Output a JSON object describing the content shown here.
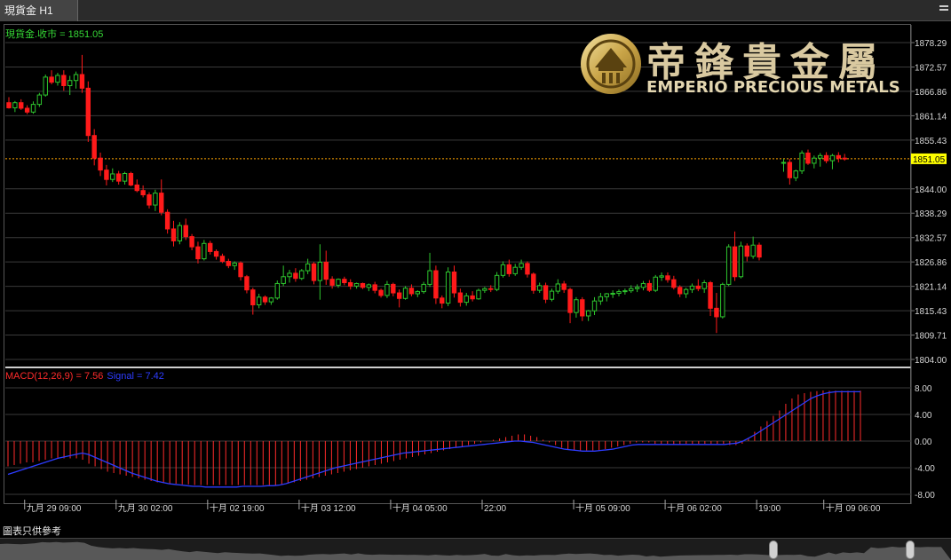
{
  "tab": {
    "title": "現貨金 H1"
  },
  "price_panel": {
    "label": "現貨金.收市 = 1851.05",
    "current_price_tag": "1851.05"
  },
  "macd_panel": {
    "label_macd": "MACD(12,26,9) = 7.56",
    "label_signal": "Signal = 7.42"
  },
  "logo": {
    "chinese": "帝鋒貴金屬",
    "english": "EMPERIO PRECIOUS METALS"
  },
  "disclaimer": "圖表只供參考",
  "colors": {
    "up": "#2ec52e",
    "down": "#ff1a1a",
    "signal": "#2d3cff",
    "histogram": "#ff2b2b",
    "current_line": "#ffa500",
    "tag_bg": "#ffff00",
    "logo_gold": "#d4af37"
  },
  "chart_data": {
    "type": "candlestick",
    "title": "現貨金.收市 = 1851.05",
    "y_ticks": [
      "1878.29",
      "1872.57",
      "1866.86",
      "1861.14",
      "1855.43",
      "1844.00",
      "1838.29",
      "1832.57",
      "1826.86",
      "1821.14",
      "1815.43",
      "1809.71",
      "1804.00"
    ],
    "ylim": [
      1804.0,
      1880.5
    ],
    "current_price": 1851.05,
    "x_ticks": [
      {
        "label": "九月 29 09:00",
        "index": 2
      },
      {
        "label": "九月 30 02:00",
        "index": 17
      },
      {
        "label": "十月 02 19:00",
        "index": 32
      },
      {
        "label": "十月 03 12:00",
        "index": 47
      },
      {
        "label": "十月 04 05:00",
        "index": 62
      },
      {
        "label": "22:00",
        "index": 77
      },
      {
        "label": "十月 05 09:00",
        "index": 92
      },
      {
        "label": "十月 06 02:00",
        "index": 107
      },
      {
        "label": "19:00",
        "index": 122
      },
      {
        "label": "十月 09 06:00",
        "index": 133
      }
    ],
    "candles": [
      [
        1864.2,
        1865.5,
        1862.8,
        1863.0
      ],
      [
        1863.0,
        1864.6,
        1862.0,
        1864.2
      ],
      [
        1864.2,
        1865.0,
        1862.5,
        1862.9
      ],
      [
        1862.9,
        1863.6,
        1861.5,
        1862.0
      ],
      [
        1862.0,
        1864.5,
        1861.6,
        1863.8
      ],
      [
        1863.8,
        1866.5,
        1863.2,
        1866.0
      ],
      [
        1866.0,
        1870.8,
        1865.6,
        1870.2
      ],
      [
        1870.2,
        1871.8,
        1868.5,
        1869.0
      ],
      [
        1869.0,
        1871.2,
        1868.2,
        1870.6
      ],
      [
        1870.6,
        1871.8,
        1867.0,
        1868.2
      ],
      [
        1868.2,
        1870.5,
        1866.0,
        1869.4
      ],
      [
        1869.4,
        1871.5,
        1867.5,
        1870.8
      ],
      [
        1870.8,
        1875.4,
        1866.5,
        1867.6
      ],
      [
        1867.6,
        1869.2,
        1855.0,
        1856.5
      ],
      [
        1856.5,
        1858.0,
        1849.5,
        1851.2
      ],
      [
        1851.2,
        1852.5,
        1847.0,
        1848.4
      ],
      [
        1848.4,
        1849.6,
        1844.8,
        1846.2
      ],
      [
        1846.2,
        1848.8,
        1845.6,
        1847.5
      ],
      [
        1847.5,
        1848.2,
        1845.0,
        1845.8
      ],
      [
        1845.8,
        1848.0,
        1845.0,
        1847.6
      ],
      [
        1847.6,
        1848.0,
        1844.6,
        1844.9
      ],
      [
        1844.9,
        1846.2,
        1843.2,
        1843.6
      ],
      [
        1843.6,
        1844.8,
        1842.0,
        1842.6
      ],
      [
        1842.6,
        1843.2,
        1839.4,
        1840.2
      ],
      [
        1840.2,
        1843.8,
        1838.8,
        1843.0
      ],
      [
        1843.0,
        1846.2,
        1837.8,
        1838.5
      ],
      [
        1838.5,
        1839.2,
        1833.5,
        1834.6
      ],
      [
        1834.6,
        1836.5,
        1830.5,
        1831.8
      ],
      [
        1831.8,
        1836.2,
        1831.0,
        1835.4
      ],
      [
        1835.4,
        1837.0,
        1832.0,
        1832.8
      ],
      [
        1832.8,
        1833.4,
        1829.6,
        1830.4
      ],
      [
        1830.4,
        1831.6,
        1826.5,
        1827.6
      ],
      [
        1827.6,
        1832.0,
        1827.2,
        1831.2
      ],
      [
        1831.2,
        1831.8,
        1828.6,
        1829.3
      ],
      [
        1829.3,
        1829.8,
        1827.4,
        1828.2
      ],
      [
        1828.2,
        1828.8,
        1826.6,
        1827.0
      ],
      [
        1827.0,
        1827.6,
        1825.4,
        1826.0
      ],
      [
        1826.0,
        1827.0,
        1825.0,
        1826.6
      ],
      [
        1826.6,
        1827.0,
        1822.5,
        1823.4
      ],
      [
        1823.4,
        1823.8,
        1819.5,
        1820.3
      ],
      [
        1820.3,
        1820.8,
        1814.5,
        1816.8
      ],
      [
        1816.8,
        1819.4,
        1816.0,
        1818.6
      ],
      [
        1818.6,
        1819.0,
        1816.8,
        1817.5
      ],
      [
        1817.5,
        1818.6,
        1816.8,
        1818.4
      ],
      [
        1818.4,
        1822.5,
        1818.0,
        1821.8
      ],
      [
        1821.8,
        1826.0,
        1821.2,
        1823.4
      ],
      [
        1823.4,
        1825.0,
        1822.0,
        1824.2
      ],
      [
        1824.2,
        1825.4,
        1822.2,
        1823.0
      ],
      [
        1823.0,
        1825.2,
        1822.6,
        1824.8
      ],
      [
        1824.8,
        1827.6,
        1824.0,
        1826.4
      ],
      [
        1826.4,
        1826.8,
        1821.6,
        1822.5
      ],
      [
        1822.5,
        1831.0,
        1818.0,
        1826.8
      ],
      [
        1826.8,
        1829.5,
        1821.5,
        1822.8
      ],
      [
        1822.8,
        1823.5,
        1820.6,
        1821.4
      ],
      [
        1821.4,
        1823.0,
        1820.8,
        1822.8
      ],
      [
        1822.8,
        1823.4,
        1821.4,
        1822.0
      ],
      [
        1822.0,
        1822.8,
        1820.4,
        1821.2
      ],
      [
        1821.2,
        1822.0,
        1820.6,
        1821.8
      ],
      [
        1821.8,
        1822.0,
        1820.5,
        1820.9
      ],
      [
        1820.9,
        1821.8,
        1820.0,
        1821.5
      ],
      [
        1821.5,
        1822.2,
        1819.5,
        1820.2
      ],
      [
        1820.2,
        1820.6,
        1818.5,
        1819.0
      ],
      [
        1819.0,
        1822.4,
        1818.4,
        1821.6
      ],
      [
        1821.6,
        1822.0,
        1818.8,
        1819.6
      ],
      [
        1819.6,
        1820.4,
        1816.2,
        1818.3
      ],
      [
        1818.3,
        1821.2,
        1818.0,
        1820.7
      ],
      [
        1820.7,
        1821.6,
        1818.8,
        1819.4
      ],
      [
        1819.4,
        1820.2,
        1818.6,
        1819.9
      ],
      [
        1819.9,
        1822.2,
        1819.4,
        1821.6
      ],
      [
        1821.6,
        1829.0,
        1821.0,
        1824.8
      ],
      [
        1824.8,
        1826.0,
        1817.0,
        1818.4
      ],
      [
        1818.4,
        1819.0,
        1816.0,
        1817.2
      ],
      [
        1817.2,
        1825.6,
        1816.5,
        1824.5
      ],
      [
        1824.5,
        1826.0,
        1818.5,
        1819.6
      ],
      [
        1819.6,
        1820.6,
        1816.4,
        1817.4
      ],
      [
        1817.4,
        1819.6,
        1816.6,
        1818.9
      ],
      [
        1818.9,
        1820.0,
        1817.6,
        1818.2
      ],
      [
        1818.2,
        1820.6,
        1818.0,
        1820.2
      ],
      [
        1820.2,
        1821.0,
        1819.6,
        1820.6
      ],
      [
        1820.6,
        1821.4,
        1819.8,
        1820.4
      ],
      [
        1820.4,
        1824.5,
        1820.0,
        1823.7
      ],
      [
        1823.7,
        1827.0,
        1823.2,
        1826.2
      ],
      [
        1826.2,
        1827.4,
        1823.4,
        1824.1
      ],
      [
        1824.1,
        1826.4,
        1823.6,
        1825.6
      ],
      [
        1825.6,
        1827.4,
        1825.0,
        1826.5
      ],
      [
        1826.5,
        1827.0,
        1823.2,
        1824.0
      ],
      [
        1824.0,
        1824.4,
        1819.4,
        1820.2
      ],
      [
        1820.2,
        1822.0,
        1819.6,
        1821.3
      ],
      [
        1821.3,
        1822.0,
        1817.2,
        1818.1
      ],
      [
        1818.1,
        1820.6,
        1817.6,
        1820.0
      ],
      [
        1820.0,
        1822.8,
        1819.4,
        1821.7
      ],
      [
        1821.7,
        1822.4,
        1819.6,
        1820.4
      ],
      [
        1820.4,
        1820.8,
        1812.5,
        1815.0
      ],
      [
        1815.0,
        1818.6,
        1813.8,
        1818.0
      ],
      [
        1818.0,
        1818.6,
        1813.0,
        1814.2
      ],
      [
        1814.2,
        1815.6,
        1813.0,
        1815.4
      ],
      [
        1815.4,
        1818.6,
        1814.4,
        1817.7
      ],
      [
        1817.7,
        1819.6,
        1816.8,
        1818.7
      ],
      [
        1818.7,
        1819.6,
        1817.6,
        1819.4
      ],
      [
        1819.4,
        1820.2,
        1818.4,
        1819.5
      ],
      [
        1819.5,
        1820.4,
        1818.8,
        1819.9
      ],
      [
        1819.9,
        1820.6,
        1819.2,
        1820.1
      ],
      [
        1820.1,
        1821.4,
        1819.6,
        1820.6
      ],
      [
        1820.6,
        1821.6,
        1819.8,
        1820.9
      ],
      [
        1820.9,
        1822.4,
        1820.2,
        1821.8
      ],
      [
        1821.8,
        1822.6,
        1819.8,
        1820.2
      ],
      [
        1820.2,
        1823.8,
        1819.8,
        1823.3
      ],
      [
        1823.3,
        1824.4,
        1822.4,
        1823.6
      ],
      [
        1823.6,
        1824.4,
        1822.0,
        1822.7
      ],
      [
        1822.7,
        1823.6,
        1820.4,
        1820.9
      ],
      [
        1820.9,
        1821.4,
        1818.6,
        1819.4
      ],
      [
        1819.4,
        1820.8,
        1818.4,
        1820.4
      ],
      [
        1820.4,
        1821.8,
        1819.6,
        1821.2
      ],
      [
        1821.2,
        1822.8,
        1820.0,
        1820.6
      ],
      [
        1820.6,
        1822.6,
        1819.6,
        1822.0
      ],
      [
        1822.0,
        1822.4,
        1814.2,
        1816.0
      ],
      [
        1816.0,
        1819.6,
        1810.2,
        1814.0
      ],
      [
        1814.0,
        1822.0,
        1813.6,
        1821.6
      ],
      [
        1821.6,
        1831.0,
        1821.2,
        1830.4
      ],
      [
        1830.4,
        1834.0,
        1822.4,
        1823.4
      ],
      [
        1823.4,
        1831.6,
        1823.0,
        1830.6
      ],
      [
        1830.6,
        1831.2,
        1827.0,
        1828.2
      ],
      [
        1828.2,
        1832.8,
        1827.6,
        1830.8
      ],
      [
        1830.8,
        1831.4,
        1827.2,
        1828.0
      ]
    ],
    "candles_after_gap": [
      [
        1850.2,
        1851.0,
        1848.0,
        1850.2
      ],
      [
        1850.2,
        1851.0,
        1845.0,
        1846.6
      ],
      [
        1846.6,
        1848.5,
        1845.8,
        1848.2
      ],
      [
        1848.2,
        1853.0,
        1847.5,
        1852.4
      ],
      [
        1852.4,
        1853.2,
        1849.6,
        1850.0
      ],
      [
        1850.0,
        1851.8,
        1848.8,
        1851.2
      ],
      [
        1851.2,
        1852.4,
        1849.2,
        1851.8
      ],
      [
        1851.8,
        1852.6,
        1850.0,
        1850.6
      ],
      [
        1850.6,
        1852.2,
        1848.6,
        1851.8
      ],
      [
        1851.8,
        1852.6,
        1850.2,
        1851.2
      ],
      [
        1851.2,
        1852.2,
        1850.6,
        1851.05
      ]
    ],
    "gap_start_index": 127,
    "macd": {
      "label": "MACD(12,26,9) = 7.56",
      "signal_label": "Signal = 7.42",
      "y_ticks": [
        "8.00",
        "4.00",
        "0.00",
        "-4.00",
        "-8.00"
      ],
      "ylim": [
        -9.5,
        9.5
      ],
      "histogram": [
        -3.8,
        -3.6,
        -3.4,
        -3.2,
        -3.2,
        -3.0,
        -2.8,
        -2.6,
        -2.6,
        -2.6,
        -2.6,
        -2.6,
        -2.8,
        -3.4,
        -3.8,
        -4.2,
        -4.6,
        -4.8,
        -5.0,
        -5.2,
        -5.4,
        -5.6,
        -5.8,
        -6.0,
        -6.2,
        -6.3,
        -6.4,
        -6.4,
        -6.5,
        -6.5,
        -6.6,
        -6.6,
        -6.6,
        -6.6,
        -6.6,
        -6.6,
        -6.6,
        -6.6,
        -6.6,
        -6.6,
        -6.6,
        -6.6,
        -6.6,
        -6.6,
        -6.5,
        -6.4,
        -6.2,
        -6.0,
        -5.8,
        -5.6,
        -5.4,
        -5.2,
        -5.0,
        -4.8,
        -4.6,
        -4.4,
        -4.2,
        -4.0,
        -3.8,
        -3.6,
        -3.4,
        -3.2,
        -3.0,
        -2.8,
        -2.6,
        -2.4,
        -2.2,
        -2.0,
        -1.8,
        -1.6,
        -1.4,
        -1.2,
        -1.0,
        -0.8,
        -0.6,
        -0.4,
        -0.2,
        0.0,
        0.2,
        0.4,
        0.6,
        0.8,
        1.0,
        1.0,
        0.8,
        0.6,
        0.2,
        -0.2,
        -0.6,
        -1.0,
        -1.2,
        -1.4,
        -1.4,
        -1.4,
        -1.4,
        -1.4,
        -1.2,
        -1.0,
        -0.8,
        -0.6,
        -0.4,
        -0.2,
        -0.2,
        -0.2,
        -0.4,
        -0.4,
        -0.4,
        -0.6,
        -0.6,
        -0.4,
        -0.4,
        -0.4,
        -0.4,
        -0.4,
        -0.4,
        -0.4,
        -0.6,
        -0.6,
        -0.4,
        0.4,
        1.4,
        2.2,
        3.0,
        3.8,
        4.6,
        5.6,
        6.4,
        7.0,
        7.2,
        7.4,
        7.5,
        7.6,
        7.56,
        7.56,
        7.56,
        7.56,
        7.56,
        7.56
      ],
      "signal": [
        -5.0,
        -4.7,
        -4.4,
        -4.1,
        -3.8,
        -3.5,
        -3.2,
        -2.9,
        -2.6,
        -2.4,
        -2.2,
        -2.0,
        -1.8,
        -2.0,
        -2.4,
        -2.8,
        -3.2,
        -3.6,
        -4.0,
        -4.4,
        -4.8,
        -5.1,
        -5.4,
        -5.7,
        -6.0,
        -6.2,
        -6.4,
        -6.5,
        -6.6,
        -6.7,
        -6.8,
        -6.8,
        -6.9,
        -6.9,
        -6.9,
        -6.9,
        -6.9,
        -6.9,
        -6.8,
        -6.8,
        -6.8,
        -6.8,
        -6.7,
        -6.7,
        -6.6,
        -6.4,
        -6.1,
        -5.8,
        -5.5,
        -5.2,
        -4.9,
        -4.6,
        -4.3,
        -4.0,
        -3.8,
        -3.6,
        -3.4,
        -3.2,
        -3.0,
        -2.8,
        -2.6,
        -2.4,
        -2.2,
        -2.0,
        -1.8,
        -1.7,
        -1.6,
        -1.5,
        -1.4,
        -1.3,
        -1.2,
        -1.1,
        -1.0,
        -0.9,
        -0.8,
        -0.7,
        -0.6,
        -0.5,
        -0.4,
        -0.3,
        -0.2,
        -0.1,
        0.0,
        0.0,
        -0.1,
        -0.2,
        -0.4,
        -0.6,
        -0.8,
        -1.0,
        -1.2,
        -1.3,
        -1.4,
        -1.5,
        -1.5,
        -1.5,
        -1.4,
        -1.3,
        -1.2,
        -1.0,
        -0.8,
        -0.6,
        -0.5,
        -0.5,
        -0.5,
        -0.5,
        -0.5,
        -0.5,
        -0.5,
        -0.5,
        -0.5,
        -0.5,
        -0.5,
        -0.5,
        -0.5,
        -0.5,
        -0.5,
        -0.4,
        -0.3,
        0.0,
        0.5,
        1.0,
        1.6,
        2.2,
        2.8,
        3.4,
        4.0,
        4.6,
        5.2,
        5.8,
        6.4,
        6.8,
        7.1,
        7.3,
        7.42,
        7.42,
        7.42,
        7.42,
        7.42
      ]
    }
  }
}
